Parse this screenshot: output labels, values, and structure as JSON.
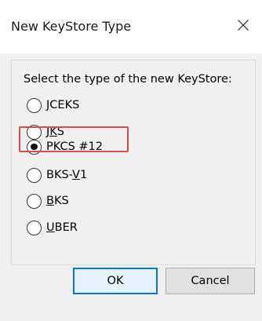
{
  "dialog": {
    "title": "New KeyStore Type",
    "prompt": "Select the type of the new KeyStore:",
    "options": [
      {
        "pre": "",
        "mnemonic": "J",
        "post": "CEKS",
        "checked": false
      },
      {
        "pre": "J",
        "mnemonic": "K",
        "post": "S",
        "checked": false
      },
      {
        "pre": "",
        "mnemonic": "P",
        "post": "KCS #12",
        "checked": true
      },
      {
        "pre": "BKS-",
        "mnemonic": "V",
        "post": "1",
        "checked": false
      },
      {
        "pre": "",
        "mnemonic": "B",
        "post": "KS",
        "checked": false
      },
      {
        "pre": "",
        "mnemonic": "U",
        "post": "BER",
        "checked": false
      }
    ],
    "ok_label": "OK",
    "cancel_label": "Cancel"
  },
  "colors": {
    "highlight": "#e04a4a",
    "ok_border": "#0078d7"
  },
  "icons": {
    "close": "close-icon"
  }
}
